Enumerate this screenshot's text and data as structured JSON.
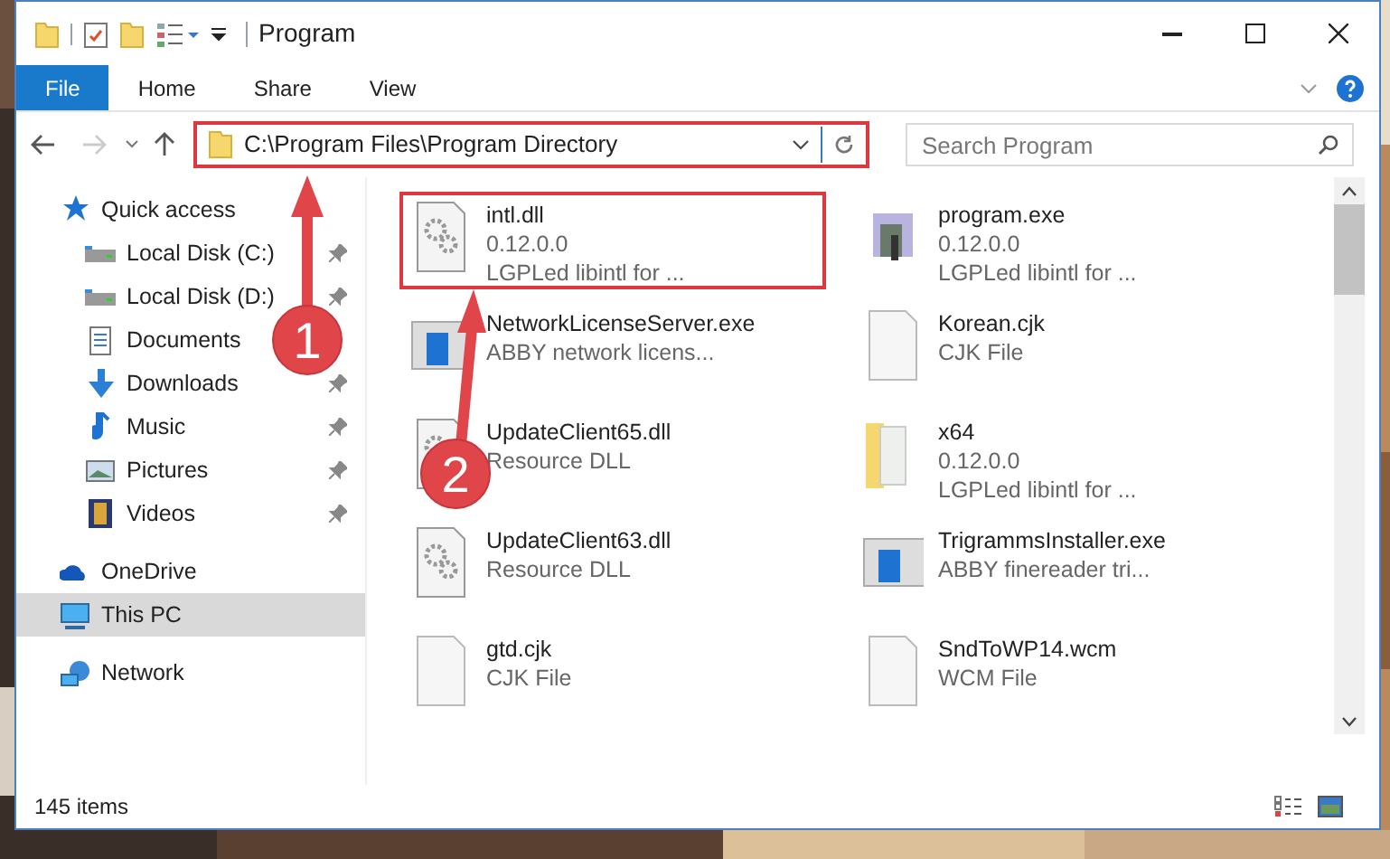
{
  "window": {
    "title": "Program"
  },
  "ribbon": {
    "tabs": [
      {
        "label": "File",
        "selected": true
      },
      {
        "label": "Home",
        "selected": false
      },
      {
        "label": "Share",
        "selected": false
      },
      {
        "label": "View",
        "selected": false
      }
    ]
  },
  "address_bar": {
    "path": "C:\\Program Files\\Program Directory",
    "highlighted": true
  },
  "search": {
    "placeholder": "Search Program"
  },
  "sidebar": {
    "items": [
      {
        "label": "Quick access",
        "kind": "star",
        "selected": false,
        "pinned": false,
        "children": [
          {
            "label": "Local Disk (C:)",
            "kind": "disk",
            "selected": false,
            "pinned": true
          },
          {
            "label": "Local Disk (D:)",
            "kind": "disk",
            "selected": false,
            "pinned": true
          },
          {
            "label": "Documents",
            "kind": "docs",
            "selected": false,
            "pinned": false
          },
          {
            "label": "Downloads",
            "kind": "download",
            "selected": false,
            "pinned": true
          },
          {
            "label": "Music",
            "kind": "music",
            "selected": false,
            "pinned": true
          },
          {
            "label": "Pictures",
            "kind": "pictures",
            "selected": false,
            "pinned": true
          },
          {
            "label": "Videos",
            "kind": "videos",
            "selected": false,
            "pinned": true
          }
        ]
      },
      {
        "label": "OneDrive",
        "kind": "cloud",
        "selected": false,
        "pinned": false
      },
      {
        "label": "This PC",
        "kind": "pc",
        "selected": true,
        "pinned": false
      },
      {
        "label": "Network",
        "kind": "network",
        "selected": false,
        "pinned": false
      }
    ]
  },
  "files": [
    {
      "name": "intl.dll",
      "lines": [
        "0.12.0.0",
        "LGPLed libintl for ..."
      ],
      "kind": "dll",
      "highlighted": true
    },
    {
      "name": "program.exe",
      "lines": [
        "0.12.0.0",
        "LGPLed libintl for ..."
      ],
      "kind": "exe",
      "highlighted": false
    },
    {
      "name": "NetworkLicenseServer.exe",
      "lines": [
        "ABBY network licens..."
      ],
      "kind": "app",
      "highlighted": false
    },
    {
      "name": "Korean.cjk",
      "lines": [
        "CJK File"
      ],
      "kind": "file",
      "highlighted": false
    },
    {
      "name": "UpdateClient65.dll",
      "lines": [
        "Resource DLL"
      ],
      "kind": "dll",
      "highlighted": false
    },
    {
      "name": "x64",
      "lines": [
        "0.12.0.0",
        "LGPLed libintl for ..."
      ],
      "kind": "folder",
      "highlighted": false
    },
    {
      "name": "UpdateClient63.dll",
      "lines": [
        "Resource DLL"
      ],
      "kind": "dll",
      "highlighted": false
    },
    {
      "name": "TrigrammsInstaller.exe",
      "lines": [
        "ABBY finereader tri..."
      ],
      "kind": "app",
      "highlighted": false
    },
    {
      "name": "gtd.cjk",
      "lines": [
        "CJK File"
      ],
      "kind": "file",
      "highlighted": false
    },
    {
      "name": "SndToWP14.wcm",
      "lines": [
        "WCM File"
      ],
      "kind": "file",
      "highlighted": false
    }
  ],
  "status_bar": {
    "count": "145 items"
  },
  "annotations": [
    {
      "label": "1"
    },
    {
      "label": "2"
    }
  ]
}
